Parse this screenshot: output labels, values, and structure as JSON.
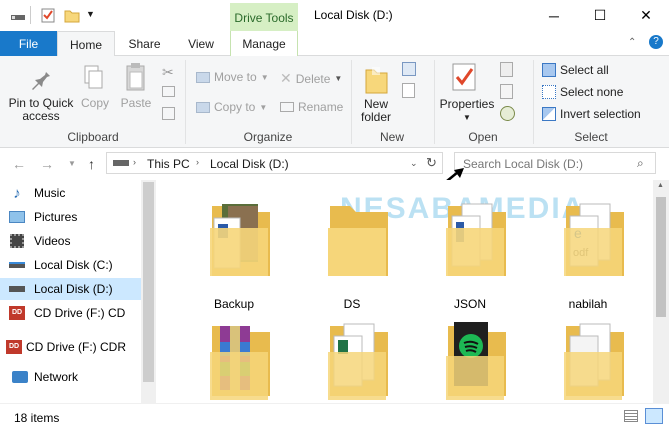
{
  "window": {
    "title": "Local Disk (D:)",
    "context_tab_group": "Drive Tools",
    "controls": {
      "minimize": "─",
      "maximize": "☐",
      "close": "✕"
    }
  },
  "tabs": {
    "file": "File",
    "home": "Home",
    "share": "Share",
    "view": "View",
    "manage": "Manage"
  },
  "ribbon": {
    "clipboard": {
      "label": "Clipboard",
      "pin_line1": "Pin to Quick",
      "pin_line2": "access",
      "copy": "Copy",
      "paste": "Paste"
    },
    "organize": {
      "label": "Organize",
      "move_to": "Move to",
      "copy_to": "Copy to",
      "delete": "Delete",
      "rename": "Rename"
    },
    "new": {
      "label": "New",
      "new_folder_line1": "New",
      "new_folder_line2": "folder"
    },
    "open": {
      "label": "Open",
      "properties": "Properties"
    },
    "select": {
      "label": "Select",
      "select_all": "Select all",
      "select_none": "Select none",
      "invert": "Invert selection"
    }
  },
  "address": {
    "this_pc": "This PC",
    "local_disk": "Local Disk (D:)",
    "search_placeholder": "Search Local Disk (D:)"
  },
  "sidebar": {
    "items": [
      {
        "label": "Music",
        "icon": "music-icon"
      },
      {
        "label": "Pictures",
        "icon": "pictures-icon"
      },
      {
        "label": "Videos",
        "icon": "videos-icon"
      },
      {
        "label": "Local Disk (C:)",
        "icon": "drive-icon"
      },
      {
        "label": "Local Disk (D:)",
        "icon": "drive-icon",
        "selected": true
      },
      {
        "label": "CD Drive (F:) CD",
        "icon": "cd-drive-icon"
      },
      {
        "label": "CD Drive (F:) CDR",
        "icon": "cd-drive-icon"
      },
      {
        "label": "Network",
        "icon": "network-icon"
      }
    ]
  },
  "files": [
    {
      "name": "Backup",
      "kind": "photo"
    },
    {
      "name": "DS",
      "kind": "empty"
    },
    {
      "name": "JSON",
      "kind": "docs"
    },
    {
      "name": "nabilah",
      "kind": "pdf"
    },
    {
      "name": "",
      "kind": "winrar"
    },
    {
      "name": "",
      "kind": "excel"
    },
    {
      "name": "",
      "kind": "spotify"
    },
    {
      "name": "",
      "kind": "paper"
    }
  ],
  "watermark": "NESABAMEDIA",
  "status": {
    "items_count": "18 items"
  },
  "colors": {
    "file_tab": "#1979ca",
    "drive_tools": "#d6efc4",
    "selected_item": "#cce8ff",
    "folder": "#f7d77b"
  }
}
